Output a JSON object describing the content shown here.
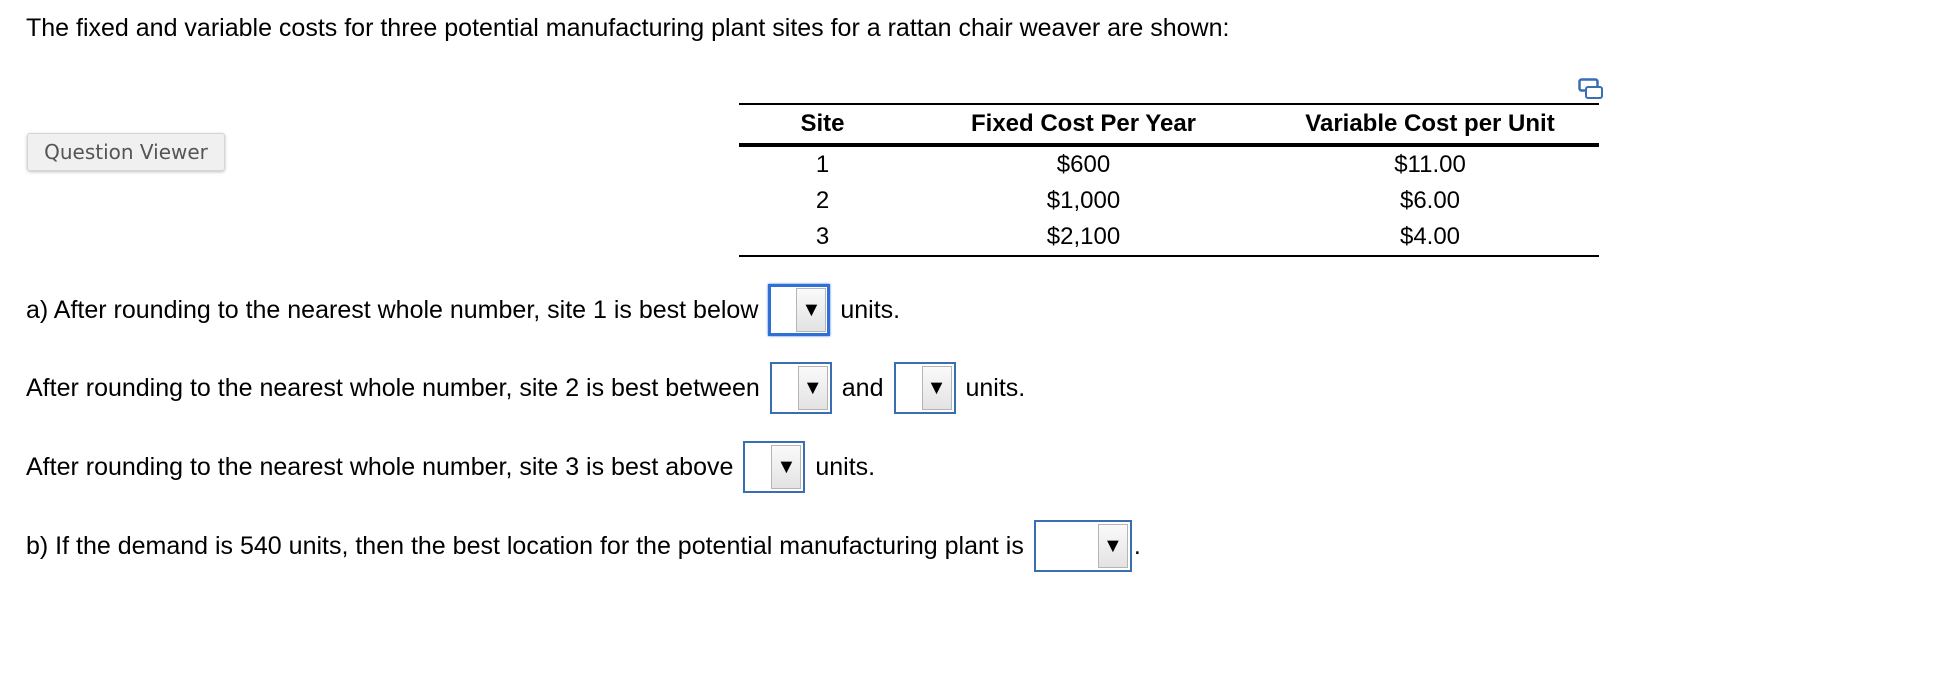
{
  "intro_text": "The fixed and variable costs for three potential manufacturing plant sites for a rattan chair weaver are shown:",
  "question_viewer_label": "Question Viewer",
  "table": {
    "headers": [
      "Site",
      "Fixed Cost Per Year",
      "Variable Cost per Unit"
    ],
    "rows": [
      [
        "1",
        "$600",
        "$11.00"
      ],
      [
        "2",
        "$1,000",
        "$6.00"
      ],
      [
        "3",
        "$2,100",
        "$4.00"
      ]
    ]
  },
  "questions": {
    "a": {
      "prefix": "a) After rounding to the nearest whole number, site 1 is best below",
      "suffix": "units.",
      "selected": ""
    },
    "site2": {
      "prefix": "After rounding to the nearest whole number, site 2 is best between",
      "middle": "and",
      "suffix": "units.",
      "selected_low": "",
      "selected_high": ""
    },
    "site3": {
      "prefix": "After rounding to the nearest whole number, site 3 is best above",
      "suffix": "units.",
      "selected": ""
    },
    "b": {
      "prefix": "b) If the demand is 540 units, then the best location for the potential manufacturing plant is",
      "suffix": ".",
      "selected": ""
    }
  },
  "icons": {
    "dropdown_arrow": "▼",
    "copy": "copy-table-icon"
  },
  "colors": {
    "dropdown_border": "#3b6db3",
    "focus_border": "#2f6fd6",
    "copy_icon": "#3b6db3"
  }
}
